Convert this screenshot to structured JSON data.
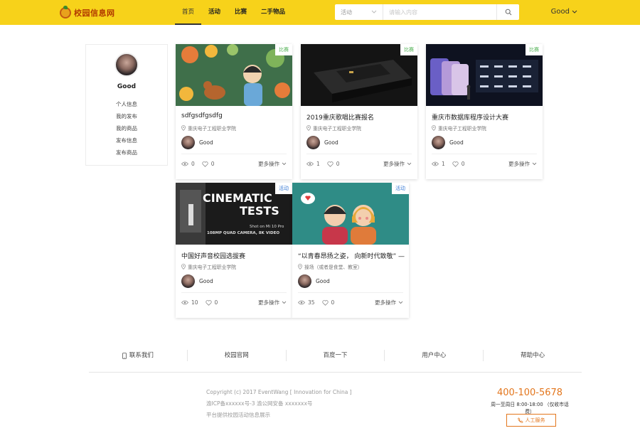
{
  "header": {
    "logo_text": "校园信息网",
    "nav": [
      "首页",
      "活动",
      "比赛",
      "二手物品"
    ],
    "search_select": "活动",
    "search_placeholder": "请输入内容",
    "user_name": "Good"
  },
  "profile": {
    "name": "Good",
    "links": [
      "个人信息",
      "我的发布",
      "我的商品",
      "发布信息",
      "发布商品"
    ]
  },
  "cards": [
    {
      "tag": "比赛",
      "title": "sdfgsdfgsdfg",
      "location": "重庆电子工程职业学院",
      "user": "Good",
      "views": "0",
      "likes": "0",
      "more": "更多操作"
    },
    {
      "tag": "比赛",
      "title": "2019重庆歌唱比赛报名",
      "location": "重庆电子工程职业学院",
      "user": "Good",
      "views": "1",
      "likes": "0",
      "more": "更多操作"
    },
    {
      "tag": "比赛",
      "title": "重庆市数据库程序设计大赛",
      "location": "重庆电子工程职业学院",
      "user": "Good",
      "views": "1",
      "likes": "0",
      "more": "更多操作"
    },
    {
      "tag": "活动",
      "title": "中国好声音校园选拔赛",
      "location": "重庆电子工程职业学院",
      "user": "Good",
      "views": "10",
      "likes": "0",
      "more": "更多操作",
      "image_text": [
        "CINEMATIC",
        "TESTS",
        "Shot on Mi 10 Pro",
        "108MP QUAD CAMERA, 8K VIDEO"
      ]
    },
    {
      "tag": "活动",
      "title": "“以青春昂扬之姿， 向新时代致敬” —",
      "location": "操场（或者是食堂、教室）",
      "user": "Good",
      "views": "35",
      "likes": "0",
      "more": "更多操作"
    }
  ],
  "footer": {
    "links": [
      "联系我们",
      "校园官网",
      "百度一下",
      "用户中心",
      "帮助中心"
    ],
    "copyright": [
      "Copyright (c) 2017 EventWang [ Innovation for China ]",
      "渝ICP备xxxxxx号-3 渝公网安备 xxxxxxx号",
      "平台提供校园活动信息展示"
    ],
    "hotline": "400-100-5678",
    "hours": "周一至周日 8:00-18:00 （仅收市话费）",
    "service_button": "人工服务"
  },
  "colors": {
    "header_bg": "#f7d21a",
    "accent": "#e3761d",
    "tag_green": "#4caf50",
    "tag_blue": "#3a7bd5"
  }
}
